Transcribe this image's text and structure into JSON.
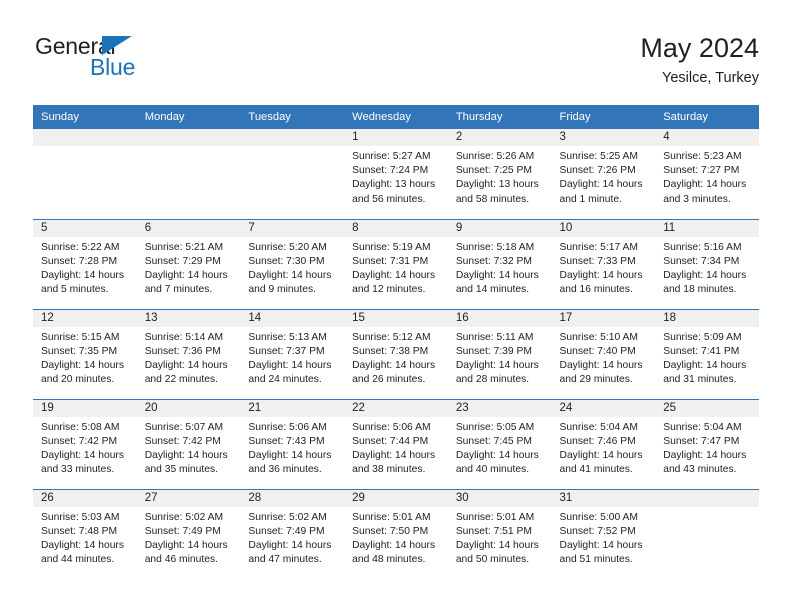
{
  "brand": {
    "name_top": "General",
    "name_bottom": "Blue",
    "triangle_icon": "triangle-icon",
    "accent_color": "#1a73bb"
  },
  "header": {
    "title": "May 2024",
    "location": "Yesilce, Turkey"
  },
  "theme": {
    "header_blue": "#3275b8",
    "daynum_band": "#f0f0f0",
    "text": "#231f20"
  },
  "weekday_headers": [
    "Sunday",
    "Monday",
    "Tuesday",
    "Wednesday",
    "Thursday",
    "Friday",
    "Saturday"
  ],
  "labels": {
    "sunrise_prefix": "Sunrise:",
    "sunset_prefix": "Sunset:",
    "daylight_prefix": "Daylight:"
  },
  "weeks": [
    [
      {
        "day": "",
        "sunrise": "",
        "sunset": "",
        "daylight_line1": "",
        "daylight_line2": "",
        "empty": true
      },
      {
        "day": "",
        "sunrise": "",
        "sunset": "",
        "daylight_line1": "",
        "daylight_line2": "",
        "empty": true
      },
      {
        "day": "",
        "sunrise": "",
        "sunset": "",
        "daylight_line1": "",
        "daylight_line2": "",
        "empty": true
      },
      {
        "day": "1",
        "sunrise": "Sunrise: 5:27 AM",
        "sunset": "Sunset: 7:24 PM",
        "daylight_line1": "Daylight: 13 hours",
        "daylight_line2": "and 56 minutes.",
        "empty": false
      },
      {
        "day": "2",
        "sunrise": "Sunrise: 5:26 AM",
        "sunset": "Sunset: 7:25 PM",
        "daylight_line1": "Daylight: 13 hours",
        "daylight_line2": "and 58 minutes.",
        "empty": false
      },
      {
        "day": "3",
        "sunrise": "Sunrise: 5:25 AM",
        "sunset": "Sunset: 7:26 PM",
        "daylight_line1": "Daylight: 14 hours",
        "daylight_line2": "and 1 minute.",
        "empty": false
      },
      {
        "day": "4",
        "sunrise": "Sunrise: 5:23 AM",
        "sunset": "Sunset: 7:27 PM",
        "daylight_line1": "Daylight: 14 hours",
        "daylight_line2": "and 3 minutes.",
        "empty": false
      }
    ],
    [
      {
        "day": "5",
        "sunrise": "Sunrise: 5:22 AM",
        "sunset": "Sunset: 7:28 PM",
        "daylight_line1": "Daylight: 14 hours",
        "daylight_line2": "and 5 minutes.",
        "empty": false
      },
      {
        "day": "6",
        "sunrise": "Sunrise: 5:21 AM",
        "sunset": "Sunset: 7:29 PM",
        "daylight_line1": "Daylight: 14 hours",
        "daylight_line2": "and 7 minutes.",
        "empty": false
      },
      {
        "day": "7",
        "sunrise": "Sunrise: 5:20 AM",
        "sunset": "Sunset: 7:30 PM",
        "daylight_line1": "Daylight: 14 hours",
        "daylight_line2": "and 9 minutes.",
        "empty": false
      },
      {
        "day": "8",
        "sunrise": "Sunrise: 5:19 AM",
        "sunset": "Sunset: 7:31 PM",
        "daylight_line1": "Daylight: 14 hours",
        "daylight_line2": "and 12 minutes.",
        "empty": false
      },
      {
        "day": "9",
        "sunrise": "Sunrise: 5:18 AM",
        "sunset": "Sunset: 7:32 PM",
        "daylight_line1": "Daylight: 14 hours",
        "daylight_line2": "and 14 minutes.",
        "empty": false
      },
      {
        "day": "10",
        "sunrise": "Sunrise: 5:17 AM",
        "sunset": "Sunset: 7:33 PM",
        "daylight_line1": "Daylight: 14 hours",
        "daylight_line2": "and 16 minutes.",
        "empty": false
      },
      {
        "day": "11",
        "sunrise": "Sunrise: 5:16 AM",
        "sunset": "Sunset: 7:34 PM",
        "daylight_line1": "Daylight: 14 hours",
        "daylight_line2": "and 18 minutes.",
        "empty": false
      }
    ],
    [
      {
        "day": "12",
        "sunrise": "Sunrise: 5:15 AM",
        "sunset": "Sunset: 7:35 PM",
        "daylight_line1": "Daylight: 14 hours",
        "daylight_line2": "and 20 minutes.",
        "empty": false
      },
      {
        "day": "13",
        "sunrise": "Sunrise: 5:14 AM",
        "sunset": "Sunset: 7:36 PM",
        "daylight_line1": "Daylight: 14 hours",
        "daylight_line2": "and 22 minutes.",
        "empty": false
      },
      {
        "day": "14",
        "sunrise": "Sunrise: 5:13 AM",
        "sunset": "Sunset: 7:37 PM",
        "daylight_line1": "Daylight: 14 hours",
        "daylight_line2": "and 24 minutes.",
        "empty": false
      },
      {
        "day": "15",
        "sunrise": "Sunrise: 5:12 AM",
        "sunset": "Sunset: 7:38 PM",
        "daylight_line1": "Daylight: 14 hours",
        "daylight_line2": "and 26 minutes.",
        "empty": false
      },
      {
        "day": "16",
        "sunrise": "Sunrise: 5:11 AM",
        "sunset": "Sunset: 7:39 PM",
        "daylight_line1": "Daylight: 14 hours",
        "daylight_line2": "and 28 minutes.",
        "empty": false
      },
      {
        "day": "17",
        "sunrise": "Sunrise: 5:10 AM",
        "sunset": "Sunset: 7:40 PM",
        "daylight_line1": "Daylight: 14 hours",
        "daylight_line2": "and 29 minutes.",
        "empty": false
      },
      {
        "day": "18",
        "sunrise": "Sunrise: 5:09 AM",
        "sunset": "Sunset: 7:41 PM",
        "daylight_line1": "Daylight: 14 hours",
        "daylight_line2": "and 31 minutes.",
        "empty": false
      }
    ],
    [
      {
        "day": "19",
        "sunrise": "Sunrise: 5:08 AM",
        "sunset": "Sunset: 7:42 PM",
        "daylight_line1": "Daylight: 14 hours",
        "daylight_line2": "and 33 minutes.",
        "empty": false
      },
      {
        "day": "20",
        "sunrise": "Sunrise: 5:07 AM",
        "sunset": "Sunset: 7:42 PM",
        "daylight_line1": "Daylight: 14 hours",
        "daylight_line2": "and 35 minutes.",
        "empty": false
      },
      {
        "day": "21",
        "sunrise": "Sunrise: 5:06 AM",
        "sunset": "Sunset: 7:43 PM",
        "daylight_line1": "Daylight: 14 hours",
        "daylight_line2": "and 36 minutes.",
        "empty": false
      },
      {
        "day": "22",
        "sunrise": "Sunrise: 5:06 AM",
        "sunset": "Sunset: 7:44 PM",
        "daylight_line1": "Daylight: 14 hours",
        "daylight_line2": "and 38 minutes.",
        "empty": false
      },
      {
        "day": "23",
        "sunrise": "Sunrise: 5:05 AM",
        "sunset": "Sunset: 7:45 PM",
        "daylight_line1": "Daylight: 14 hours",
        "daylight_line2": "and 40 minutes.",
        "empty": false
      },
      {
        "day": "24",
        "sunrise": "Sunrise: 5:04 AM",
        "sunset": "Sunset: 7:46 PM",
        "daylight_line1": "Daylight: 14 hours",
        "daylight_line2": "and 41 minutes.",
        "empty": false
      },
      {
        "day": "25",
        "sunrise": "Sunrise: 5:04 AM",
        "sunset": "Sunset: 7:47 PM",
        "daylight_line1": "Daylight: 14 hours",
        "daylight_line2": "and 43 minutes.",
        "empty": false
      }
    ],
    [
      {
        "day": "26",
        "sunrise": "Sunrise: 5:03 AM",
        "sunset": "Sunset: 7:48 PM",
        "daylight_line1": "Daylight: 14 hours",
        "daylight_line2": "and 44 minutes.",
        "empty": false
      },
      {
        "day": "27",
        "sunrise": "Sunrise: 5:02 AM",
        "sunset": "Sunset: 7:49 PM",
        "daylight_line1": "Daylight: 14 hours",
        "daylight_line2": "and 46 minutes.",
        "empty": false
      },
      {
        "day": "28",
        "sunrise": "Sunrise: 5:02 AM",
        "sunset": "Sunset: 7:49 PM",
        "daylight_line1": "Daylight: 14 hours",
        "daylight_line2": "and 47 minutes.",
        "empty": false
      },
      {
        "day": "29",
        "sunrise": "Sunrise: 5:01 AM",
        "sunset": "Sunset: 7:50 PM",
        "daylight_line1": "Daylight: 14 hours",
        "daylight_line2": "and 48 minutes.",
        "empty": false
      },
      {
        "day": "30",
        "sunrise": "Sunrise: 5:01 AM",
        "sunset": "Sunset: 7:51 PM",
        "daylight_line1": "Daylight: 14 hours",
        "daylight_line2": "and 50 minutes.",
        "empty": false
      },
      {
        "day": "31",
        "sunrise": "Sunrise: 5:00 AM",
        "sunset": "Sunset: 7:52 PM",
        "daylight_line1": "Daylight: 14 hours",
        "daylight_line2": "and 51 minutes.",
        "empty": false
      },
      {
        "day": "",
        "sunrise": "",
        "sunset": "",
        "daylight_line1": "",
        "daylight_line2": "",
        "empty": true
      }
    ]
  ]
}
